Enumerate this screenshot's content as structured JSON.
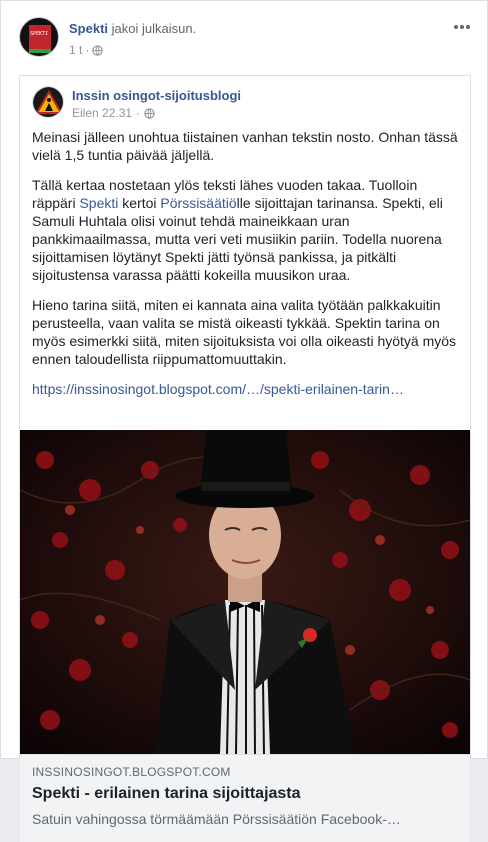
{
  "post": {
    "author": "Spekti",
    "action": "jakoi julkaisun.",
    "time": "1 t",
    "avatar_text": "SPEKTI",
    "menu_icon": "more-horizontal-icon",
    "privacy_icon": "globe-icon"
  },
  "shared_post": {
    "page_name": "Inssin osingot-sijoitusblogi",
    "time": "Eilen 22.31",
    "privacy_icon": "globe-icon",
    "paragraph1": "Meinasi jälleen unohtua tiistainen vanhan tekstin nosto. Onhan tässä vielä 1,5 tuntia päivää jäljellä.",
    "p2_before": "Tällä kertaa nostetaan ylös teksti lähes vuoden takaa. Tuolloin räppäri ",
    "p2_link1": "Spekti",
    "p2_middle": " kertoi ",
    "p2_link2": "Pörssisäätiö",
    "p2_after": "lle sijoittajan tarinansa. Spekti, eli Samuli Huhtala olisi voinut tehdä maineikkaan uran pankkimaailmassa, mutta veri veti musiikin pariin. Todella nuorena sijoittamisen löytänyt Spekti jätti työnsä pankissa, ja pitkälti sijoitustensa varassa päätti kokeilla muusikon uraa.",
    "paragraph3": "Hieno tarina siitä, miten ei kannata aina valita työtään palkkakuitin perusteella, vaan valita se mistä oikeasti tykkää. Spektin tarina on myös esimerkki siitä, miten sijoituksista voi olla oikeasti hyötyä myös ennen taloudellista riippumattomuuttakin.",
    "link_text": "https://inssinosingot.blogspot.com/…/spekti-erilainen-tarin…"
  },
  "link_preview": {
    "domain": "INSSINOSINGOT.BLOGSPOT.COM",
    "title": "Spekti - erilainen tarina sijoittajasta",
    "description": "Satuin vahingossa törmäämään Pörssisäätiön Facebook-…"
  },
  "colors": {
    "link": "#385898",
    "text": "#1d2129",
    "meta": "#90949c",
    "caption_bg": "#f2f3f5"
  }
}
